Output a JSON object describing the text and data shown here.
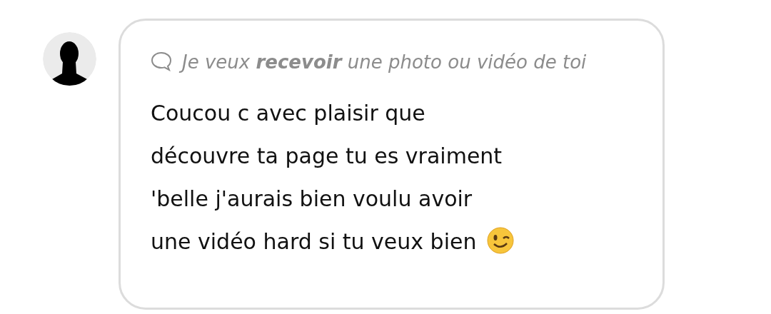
{
  "message": {
    "request": "Je veux **recevoir** une photo ou vidéo de toi",
    "text": "Coucou c avec plaisir que découvre ta page tu es vraiment 'belle j'aurais bien voulu avoir une vidéo hard si tu veux bien"
  }
}
